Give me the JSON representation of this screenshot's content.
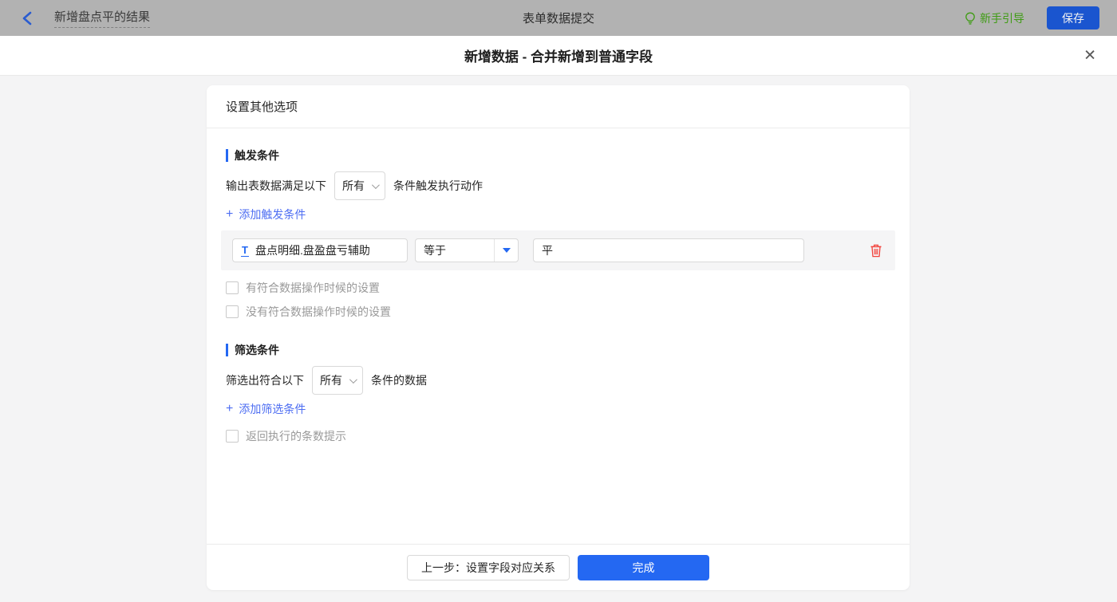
{
  "colors": {
    "topbar_bg": "#b2b2b2",
    "accent_blue": "#2468f2",
    "link_blue": "#4e6ef2",
    "save_blue": "#1a55cf",
    "guide_green": "#3f9c14",
    "danger_red": "#f2413a",
    "page_bg": "#f4f4f5"
  },
  "icons": {
    "close": "✕",
    "plus": "+",
    "text_type": "T"
  },
  "topbar": {
    "back_title": "新增盘点平的结果",
    "center_title": "表单数据提交",
    "guide_label": "新手引导",
    "save_label": "保存"
  },
  "modal": {
    "title": "新增数据 - 合并新增到普通字段"
  },
  "card": {
    "header": "设置其他选项",
    "trigger_section": {
      "title": "触发条件",
      "match_prefix": "输出表数据满足以下",
      "match_select": "所有",
      "match_suffix": "条件触发执行动作",
      "add_link": "添加触发条件",
      "condition": {
        "field": "盘点明细.盘盈盘亏辅助",
        "operator": "等于",
        "value": "平"
      },
      "checkboxes": [
        {
          "label": "有符合数据操作时候的设置",
          "checked": false
        },
        {
          "label": "没有符合数据操作时候的设置",
          "checked": false
        }
      ]
    },
    "filter_section": {
      "title": "筛选条件",
      "match_prefix": "筛选出符合以下",
      "match_select": "所有",
      "match_suffix": "条件的数据",
      "add_link": "添加筛选条件",
      "checkbox": {
        "label": "返回执行的条数提示",
        "checked": false
      }
    },
    "footer": {
      "prev_label": "上一步：设置字段对应关系",
      "done_label": "完成"
    }
  }
}
